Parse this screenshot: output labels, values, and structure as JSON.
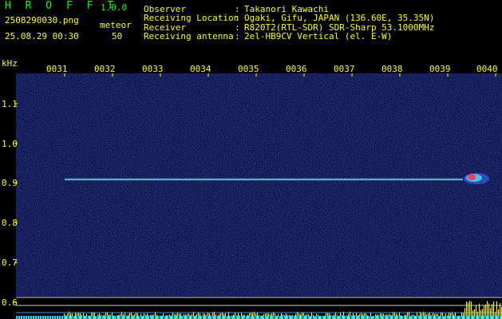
{
  "header": {
    "app_name": "H R O F F T",
    "version": "1.0.0",
    "file_name": "2508290030.png",
    "meteor_label": "meteor",
    "datetime": "25.08.29 00:30",
    "meteor_count": "50"
  },
  "info": [
    {
      "label": "Observer",
      "value": "Takanori Kawachi"
    },
    {
      "label": "Receiving Location",
      "value": "Ogaki, Gifu, JAPAN (136.60E, 35.35N)"
    },
    {
      "label": "Receiver",
      "value": "R820T2(RTL-SDR) SDR-Sharp 53.1000MHz"
    },
    {
      "label": "Receiving antenna",
      "value": "2el-HB9CV Vertical (el. E-W)"
    }
  ],
  "axis": {
    "y_unit": "kHz",
    "time_labels": [
      "0031",
      "0032",
      "0033",
      "0034",
      "0035",
      "0036",
      "0037",
      "0038",
      "0039",
      "0040"
    ],
    "freq_labels": [
      "1.1",
      "1.0",
      "0.9",
      "0.8",
      "0.7",
      "0.6"
    ]
  },
  "colors": {
    "background": "#000000",
    "text": "#ffff00",
    "title": "#00ff00",
    "noise": "#101a5c",
    "carrier": "#7fd0b0",
    "level_bars": "#ffff00"
  }
}
